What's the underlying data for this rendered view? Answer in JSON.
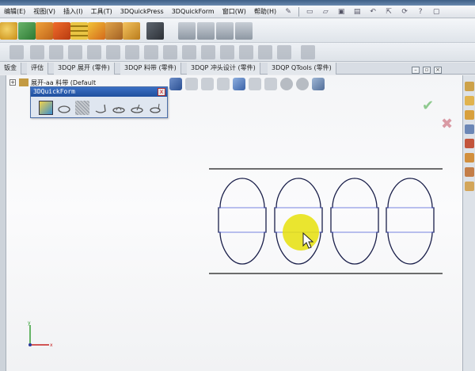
{
  "menu": {
    "items": [
      "编辑(E)",
      "视图(V)",
      "插入(I)",
      "工具(T)",
      "3DQuickPress",
      "3DQuickForm",
      "窗口(W)",
      "帮助(H)"
    ]
  },
  "tabs": [
    "钣金",
    "评估",
    "3DQP 展开 (零件)",
    "3DQP 料带 (零件)",
    "3DQP 冲头设计 (零件)",
    "3DQP QTools (零件)"
  ],
  "tree": {
    "item_label": "展开-aa 料带  (Default"
  },
  "quickform": {
    "title": "3DQuickForm",
    "close": "x"
  },
  "colors": {
    "accent": "#3a6fc4",
    "highlight": "#e6e00a",
    "ok": "#8fc98f",
    "cancel": "#d99aa4"
  }
}
